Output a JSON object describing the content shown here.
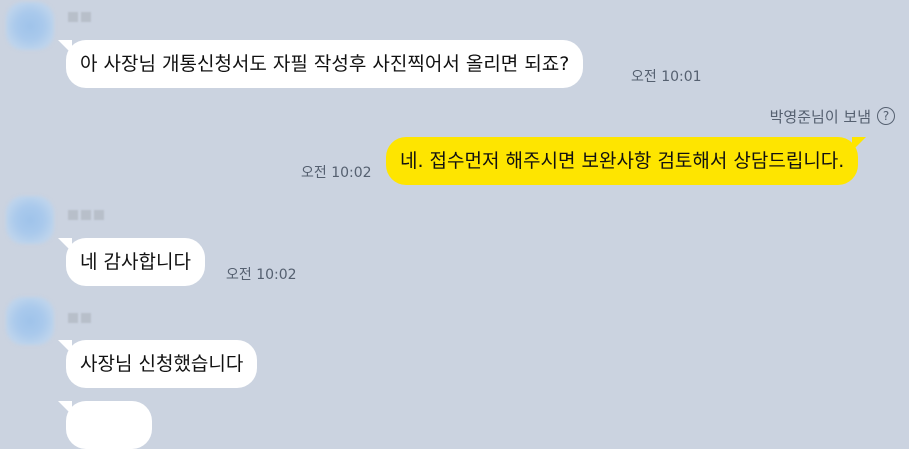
{
  "messages": [
    {
      "text": "아 사장님 개통신청서도 자필 작성후 사진찍어서 올리면 되죠?",
      "time": "오전 10:01"
    },
    {
      "text": "네. 접수먼저 해주시면 보완사항 검토해서 상담드립니다.",
      "time": "오전 10:02",
      "read_by": "박영준님이 보냄"
    },
    {
      "text": "네 감사합니다",
      "time": "오전 10:02"
    },
    {
      "text": "사장님 신청했습니다"
    }
  ],
  "icons": {
    "help": "question-circle-icon"
  },
  "colors": {
    "background": "#cbd3e0",
    "incoming_bubble": "#ffffff",
    "outgoing_bubble": "#fee500",
    "meta_text": "#556070"
  }
}
